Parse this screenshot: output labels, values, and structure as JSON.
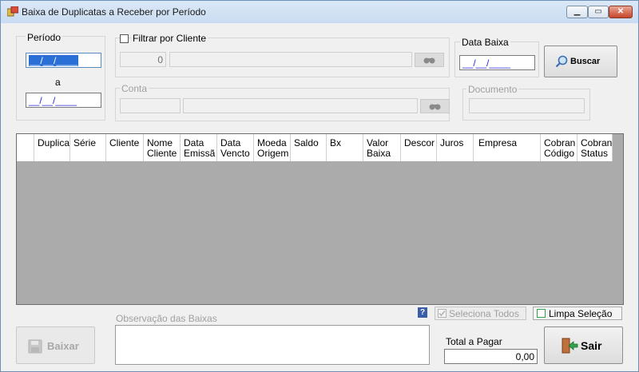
{
  "window": {
    "title": "Baixa de Duplicatas a Receber por Período"
  },
  "periodo": {
    "label": "Período",
    "from_value": "__/__/____",
    "separator": "a",
    "to_value": "__/__/____"
  },
  "cliente_filter": {
    "label": "Filtrar por Cliente",
    "checked": false,
    "code_value": "0",
    "name_value": ""
  },
  "conta": {
    "label": "Conta",
    "code_value": "",
    "name_value": ""
  },
  "data_baixa": {
    "label": "Data Baixa",
    "value": "__/__/____"
  },
  "documento": {
    "label": "Documento",
    "value": ""
  },
  "buscar_button": {
    "label": "Buscar",
    "icon": "magnifier-icon"
  },
  "grid": {
    "columns": [
      "Duplica",
      "Série",
      "Cliente",
      "Nome\nCliente",
      "Data\nEmissã",
      "Data\nVencto",
      "Moeda\nOrigem",
      "Saldo",
      "Bx",
      "Valor\nBaixa",
      "Descor",
      "Juros",
      "Empresa",
      "Cobran\nCódigo",
      "Cobran\nStatus"
    ],
    "rows": []
  },
  "help_badge": "?",
  "seleciona_todos": {
    "label": "Seleciona Todos",
    "enabled": false
  },
  "limpa_selecao": {
    "label": "Limpa Seleção"
  },
  "baixar_button": {
    "label": "Baixar",
    "enabled": false,
    "icon": "floppy-disk-icon"
  },
  "observacao": {
    "label": "Observação das Baixas",
    "value": ""
  },
  "total_pagar": {
    "label": "Total a Pagar",
    "value": "0,00"
  },
  "sair_button": {
    "label": "Sair",
    "icon": "exit-door-icon"
  },
  "colors": {
    "title_bar": "#c9dcf1",
    "grid_bg": "#ababab",
    "mask_text": "#2a2ad6",
    "accent_green": "#2fa24a"
  }
}
